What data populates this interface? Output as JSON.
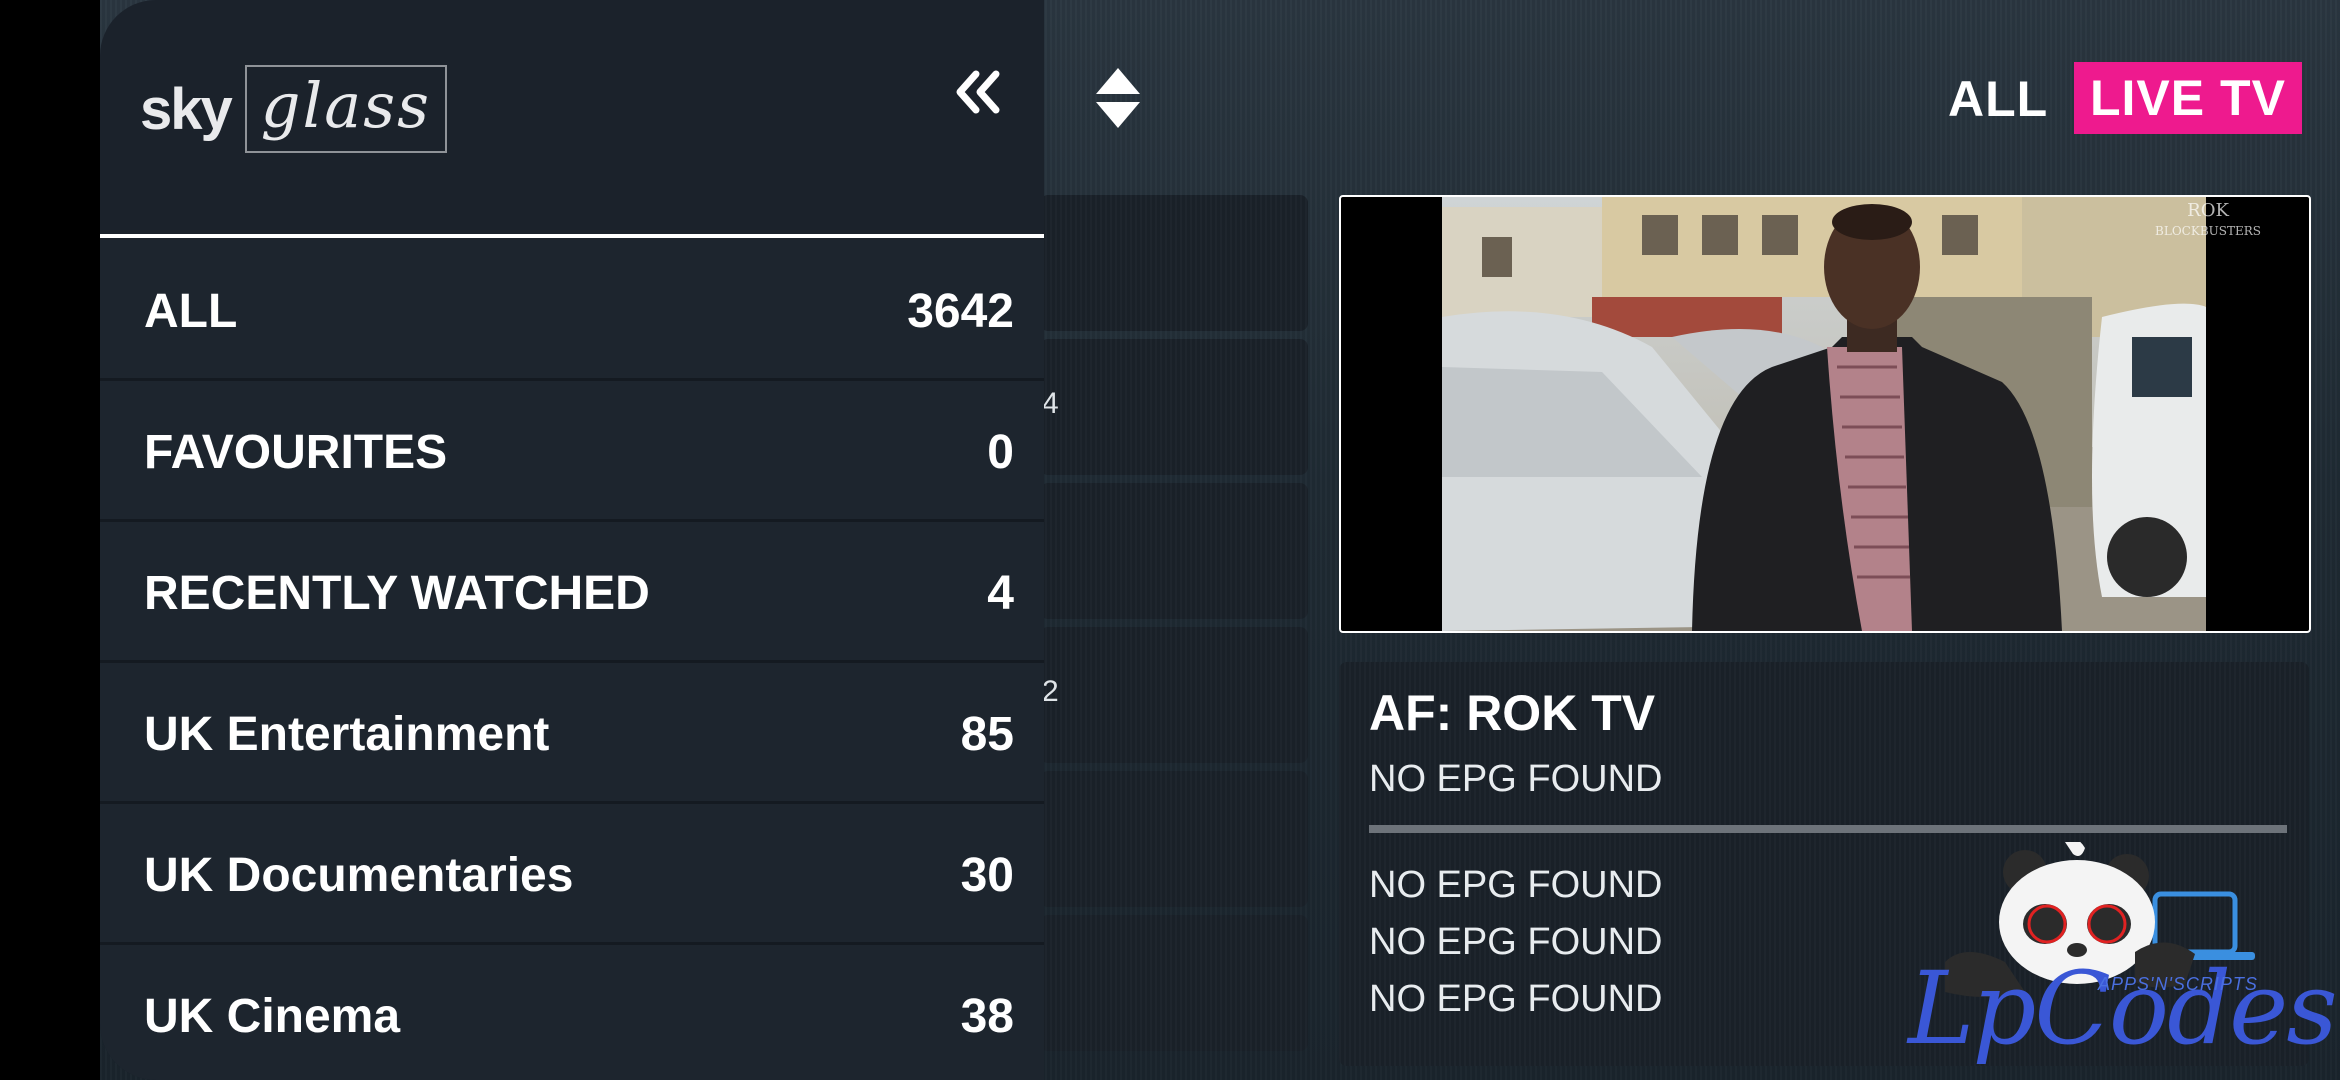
{
  "logo": {
    "part1": "sky",
    "part2": "glass"
  },
  "topbar": {
    "all_label": "ALL",
    "live_label": "LIVE TV"
  },
  "colors": {
    "accent": "#ee1a8e",
    "panel": "#1b222b",
    "watermark": "#3a57d6"
  },
  "icons": {
    "collapse": "double-chevron-left-icon",
    "sort": "sort-icon"
  },
  "categories": [
    {
      "label": "ALL",
      "count": "3642"
    },
    {
      "label": "FAVOURITES",
      "count": "0"
    },
    {
      "label": "RECENTLY WATCHED",
      "count": "4"
    },
    {
      "label": "UK Entertainment",
      "count": "85"
    },
    {
      "label": "UK Documentaries",
      "count": "30"
    },
    {
      "label": "UK Cinema",
      "count": "38"
    }
  ],
  "background_list": {
    "partial_1": "4",
    "partial_2": "2"
  },
  "preview": {
    "watermark_top": "ROK",
    "watermark_bottom": "BLOCKBUSTERS"
  },
  "epg": {
    "channel_title": "AF: ROK TV",
    "now": "NO EPG FOUND",
    "next": [
      "NO EPG FOUND",
      "NO EPG FOUND",
      "NO EPG FOUND"
    ]
  },
  "watermark": {
    "text": "LpCodes",
    "subtext": "APPS'N'SCRIPTS"
  }
}
